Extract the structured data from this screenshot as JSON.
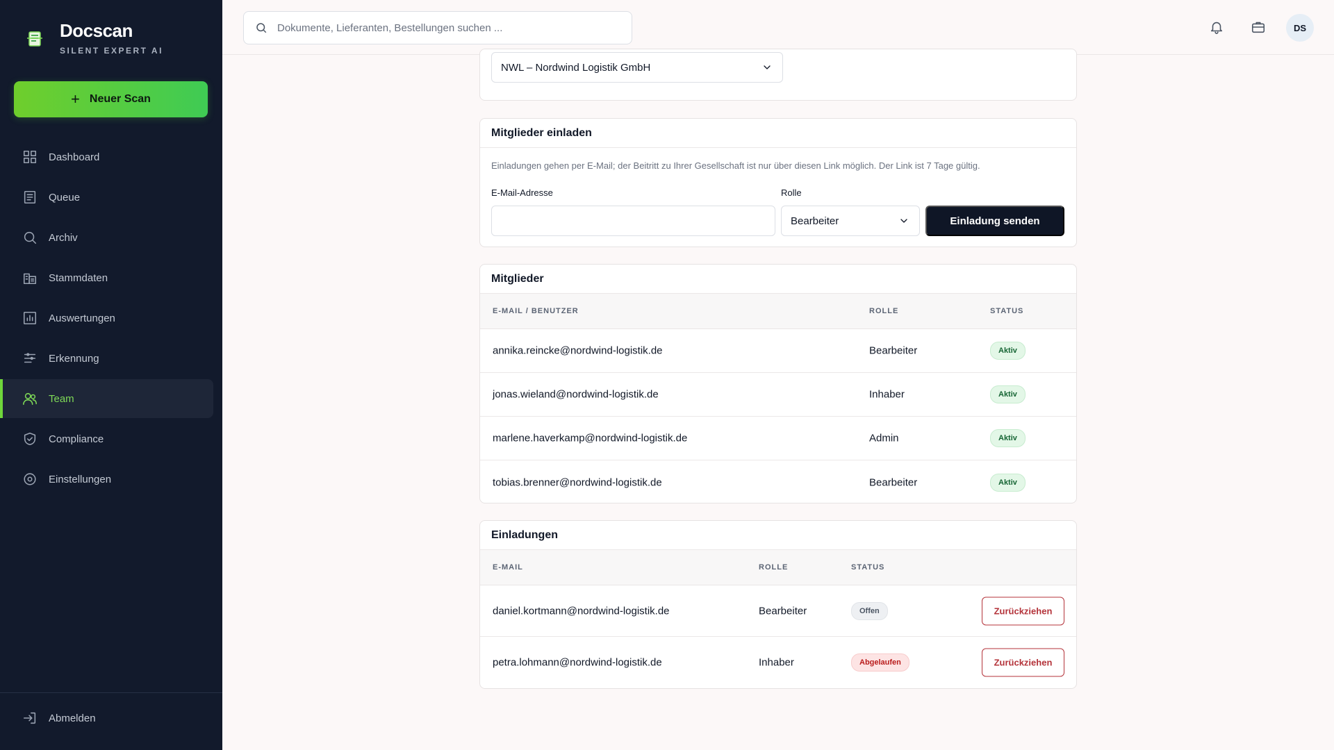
{
  "brand": {
    "name": "Docscan",
    "tagline": "SILENT EXPERT AI"
  },
  "sidebar": {
    "new_scan_label": "Neuer Scan",
    "items": [
      {
        "label": "Dashboard",
        "icon": "grid-icon"
      },
      {
        "label": "Queue",
        "icon": "list-icon"
      },
      {
        "label": "Archiv",
        "icon": "search-icon"
      },
      {
        "label": "Stammdaten",
        "icon": "building-icon"
      },
      {
        "label": "Auswertungen",
        "icon": "chart-icon"
      },
      {
        "label": "Erkennung",
        "icon": "sliders-icon"
      },
      {
        "label": "Team",
        "icon": "users-icon",
        "active": true
      },
      {
        "label": "Compliance",
        "icon": "shield-icon"
      },
      {
        "label": "Einstellungen",
        "icon": "gear-icon"
      }
    ],
    "logout_label": "Abmelden"
  },
  "topbar": {
    "search_placeholder": "Dokumente, Lieferanten, Bestellungen suchen ...",
    "avatar_initials": "DS"
  },
  "company": {
    "selected": "NWL – Nordwind Logistik GmbH"
  },
  "invite": {
    "title": "Mitglieder einladen",
    "hint": "Einladungen gehen per E-Mail; der Beitritt zu Ihrer Gesellschaft ist nur über diesen Link möglich. Der Link ist 7 Tage gültig.",
    "email_label": "E-Mail-Adresse",
    "email_value": "",
    "role_label": "Rolle",
    "role_value": "Bearbeiter",
    "send_label": "Einladung senden"
  },
  "members": {
    "title": "Mitglieder",
    "columns": [
      "E-MAIL / BENUTZER",
      "ROLLE",
      "STATUS"
    ],
    "rows": [
      {
        "email": "annika.reincke@nordwind-logistik.de",
        "role": "Bearbeiter",
        "status": "Aktiv"
      },
      {
        "email": "jonas.wieland@nordwind-logistik.de",
        "role": "Inhaber",
        "status": "Aktiv"
      },
      {
        "email": "marlene.haverkamp@nordwind-logistik.de",
        "role": "Admin",
        "status": "Aktiv"
      },
      {
        "email": "tobias.brenner@nordwind-logistik.de",
        "role": "Bearbeiter",
        "status": "Aktiv"
      }
    ]
  },
  "invitations": {
    "title": "Einladungen",
    "columns": [
      "E-MAIL",
      "ROLLE",
      "STATUS"
    ],
    "revoke_label": "Zurückziehen",
    "rows": [
      {
        "email": "daniel.kortmann@nordwind-logistik.de",
        "role": "Bearbeiter",
        "status": "Offen"
      },
      {
        "email": "petra.lohmann@nordwind-logistik.de",
        "role": "Inhaber",
        "status": "Abgelaufen"
      }
    ]
  },
  "colors": {
    "sidebar_bg": "#121a2c",
    "accent_green": "#6fd63b",
    "primary_button": "#0f1626",
    "danger": "#b4333a"
  }
}
